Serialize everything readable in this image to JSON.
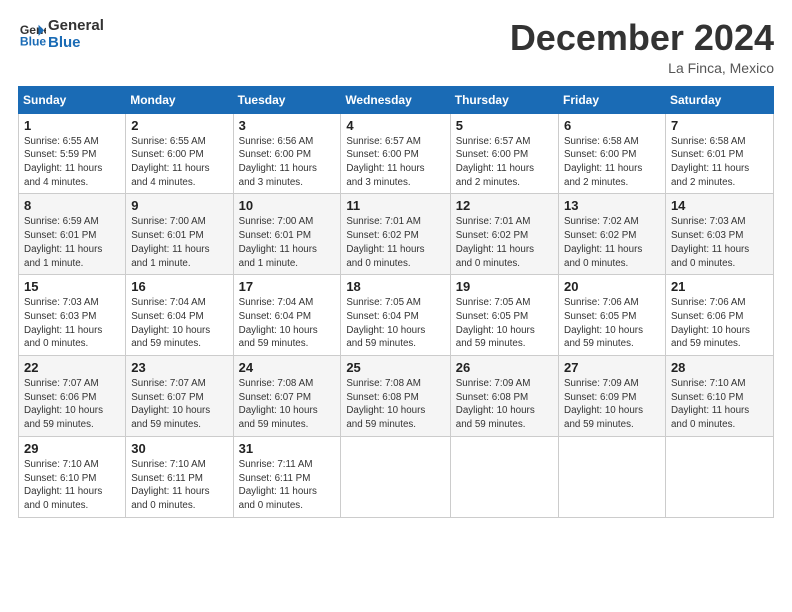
{
  "header": {
    "logo_line1": "General",
    "logo_line2": "Blue",
    "month": "December 2024",
    "location": "La Finca, Mexico"
  },
  "weekdays": [
    "Sunday",
    "Monday",
    "Tuesday",
    "Wednesday",
    "Thursday",
    "Friday",
    "Saturday"
  ],
  "weeks": [
    [
      {
        "day": "1",
        "info": "Sunrise: 6:55 AM\nSunset: 5:59 PM\nDaylight: 11 hours\nand 4 minutes."
      },
      {
        "day": "2",
        "info": "Sunrise: 6:55 AM\nSunset: 6:00 PM\nDaylight: 11 hours\nand 4 minutes."
      },
      {
        "day": "3",
        "info": "Sunrise: 6:56 AM\nSunset: 6:00 PM\nDaylight: 11 hours\nand 3 minutes."
      },
      {
        "day": "4",
        "info": "Sunrise: 6:57 AM\nSunset: 6:00 PM\nDaylight: 11 hours\nand 3 minutes."
      },
      {
        "day": "5",
        "info": "Sunrise: 6:57 AM\nSunset: 6:00 PM\nDaylight: 11 hours\nand 2 minutes."
      },
      {
        "day": "6",
        "info": "Sunrise: 6:58 AM\nSunset: 6:00 PM\nDaylight: 11 hours\nand 2 minutes."
      },
      {
        "day": "7",
        "info": "Sunrise: 6:58 AM\nSunset: 6:01 PM\nDaylight: 11 hours\nand 2 minutes."
      }
    ],
    [
      {
        "day": "8",
        "info": "Sunrise: 6:59 AM\nSunset: 6:01 PM\nDaylight: 11 hours\nand 1 minute."
      },
      {
        "day": "9",
        "info": "Sunrise: 7:00 AM\nSunset: 6:01 PM\nDaylight: 11 hours\nand 1 minute."
      },
      {
        "day": "10",
        "info": "Sunrise: 7:00 AM\nSunset: 6:01 PM\nDaylight: 11 hours\nand 1 minute."
      },
      {
        "day": "11",
        "info": "Sunrise: 7:01 AM\nSunset: 6:02 PM\nDaylight: 11 hours\nand 0 minutes."
      },
      {
        "day": "12",
        "info": "Sunrise: 7:01 AM\nSunset: 6:02 PM\nDaylight: 11 hours\nand 0 minutes."
      },
      {
        "day": "13",
        "info": "Sunrise: 7:02 AM\nSunset: 6:02 PM\nDaylight: 11 hours\nand 0 minutes."
      },
      {
        "day": "14",
        "info": "Sunrise: 7:03 AM\nSunset: 6:03 PM\nDaylight: 11 hours\nand 0 minutes."
      }
    ],
    [
      {
        "day": "15",
        "info": "Sunrise: 7:03 AM\nSunset: 6:03 PM\nDaylight: 11 hours\nand 0 minutes."
      },
      {
        "day": "16",
        "info": "Sunrise: 7:04 AM\nSunset: 6:04 PM\nDaylight: 10 hours\nand 59 minutes."
      },
      {
        "day": "17",
        "info": "Sunrise: 7:04 AM\nSunset: 6:04 PM\nDaylight: 10 hours\nand 59 minutes."
      },
      {
        "day": "18",
        "info": "Sunrise: 7:05 AM\nSunset: 6:04 PM\nDaylight: 10 hours\nand 59 minutes."
      },
      {
        "day": "19",
        "info": "Sunrise: 7:05 AM\nSunset: 6:05 PM\nDaylight: 10 hours\nand 59 minutes."
      },
      {
        "day": "20",
        "info": "Sunrise: 7:06 AM\nSunset: 6:05 PM\nDaylight: 10 hours\nand 59 minutes."
      },
      {
        "day": "21",
        "info": "Sunrise: 7:06 AM\nSunset: 6:06 PM\nDaylight: 10 hours\nand 59 minutes."
      }
    ],
    [
      {
        "day": "22",
        "info": "Sunrise: 7:07 AM\nSunset: 6:06 PM\nDaylight: 10 hours\nand 59 minutes."
      },
      {
        "day": "23",
        "info": "Sunrise: 7:07 AM\nSunset: 6:07 PM\nDaylight: 10 hours\nand 59 minutes."
      },
      {
        "day": "24",
        "info": "Sunrise: 7:08 AM\nSunset: 6:07 PM\nDaylight: 10 hours\nand 59 minutes."
      },
      {
        "day": "25",
        "info": "Sunrise: 7:08 AM\nSunset: 6:08 PM\nDaylight: 10 hours\nand 59 minutes."
      },
      {
        "day": "26",
        "info": "Sunrise: 7:09 AM\nSunset: 6:08 PM\nDaylight: 10 hours\nand 59 minutes."
      },
      {
        "day": "27",
        "info": "Sunrise: 7:09 AM\nSunset: 6:09 PM\nDaylight: 10 hours\nand 59 minutes."
      },
      {
        "day": "28",
        "info": "Sunrise: 7:10 AM\nSunset: 6:10 PM\nDaylight: 11 hours\nand 0 minutes."
      }
    ],
    [
      {
        "day": "29",
        "info": "Sunrise: 7:10 AM\nSunset: 6:10 PM\nDaylight: 11 hours\nand 0 minutes."
      },
      {
        "day": "30",
        "info": "Sunrise: 7:10 AM\nSunset: 6:11 PM\nDaylight: 11 hours\nand 0 minutes."
      },
      {
        "day": "31",
        "info": "Sunrise: 7:11 AM\nSunset: 6:11 PM\nDaylight: 11 hours\nand 0 minutes."
      },
      null,
      null,
      null,
      null
    ]
  ]
}
